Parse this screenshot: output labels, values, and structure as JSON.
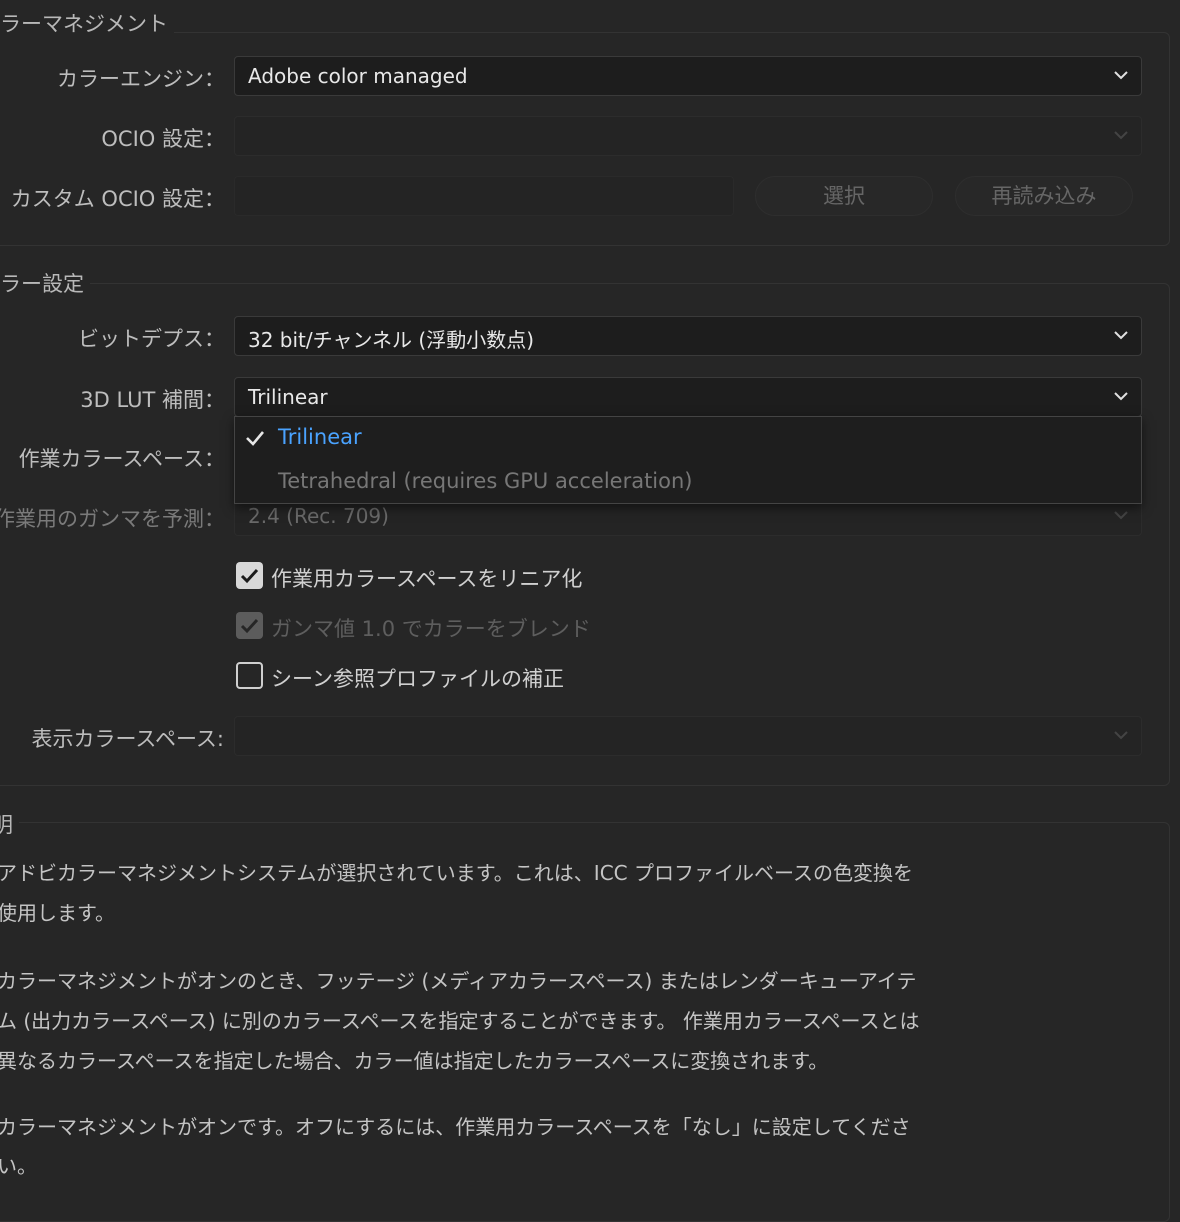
{
  "color_management": {
    "title": "ラーマネジメント",
    "engine_label": "カラーエンジン：",
    "engine_value": "Adobe color managed",
    "ocio_label": "OCIO 設定：",
    "ocio_value": "",
    "custom_ocio_label": "カスタム OCIO 設定：",
    "custom_ocio_value": "",
    "select_button": "選択",
    "reload_button": "再読み込み"
  },
  "color_settings": {
    "title": "ラー設定",
    "bit_depth_label": "ビットデプス：",
    "bit_depth_value": "32 bit/チャンネル (浮動小数点)",
    "lut_label": "3D LUT 補間：",
    "lut_value": "Trilinear",
    "working_space_label": "作業カラースペース：",
    "gamma_label": "作業用のガンマを予測：",
    "gamma_value": "2.4 (Rec. 709)",
    "linearize_label": "作業用カラースペースをリニア化",
    "linearize_checked": true,
    "blend_label": "ガンマ値 1.0 でカラーをブレンド",
    "blend_checked": true,
    "scene_label": "シーン参照プロファイルの補正",
    "scene_checked": false,
    "display_label": "表示カラースペース:",
    "display_value": ""
  },
  "lut_menu": {
    "items": [
      {
        "label": "Trilinear",
        "selected": true
      },
      {
        "label": "Tetrahedral (requires GPU acceleration)",
        "selected": false
      }
    ]
  },
  "description": {
    "title": "明",
    "lines": [
      "アドビカラーマネジメントシステムが選択されています。これは、ICC プロファイルベースの色変換を",
      "使用します。",
      "カラーマネジメントがオンのとき、フッテージ (メディアカラースペース) またはレンダーキューアイテ",
      "ム (出力カラースペース) に別のカラースペースを指定することができます。 作業用カラースペースとは",
      "異なるカラースペースを指定した場合、カラー値は指定したカラースペースに変換されます。",
      "カラーマネジメントがオンです。オフにするには、作業用カラースペースを「なし」に設定してくださ",
      "い。"
    ]
  },
  "colors": {
    "background": "#262626",
    "accent": "#4aa3ff",
    "text": "#c8c8c8",
    "disabled_text": "#6a6a6a"
  }
}
